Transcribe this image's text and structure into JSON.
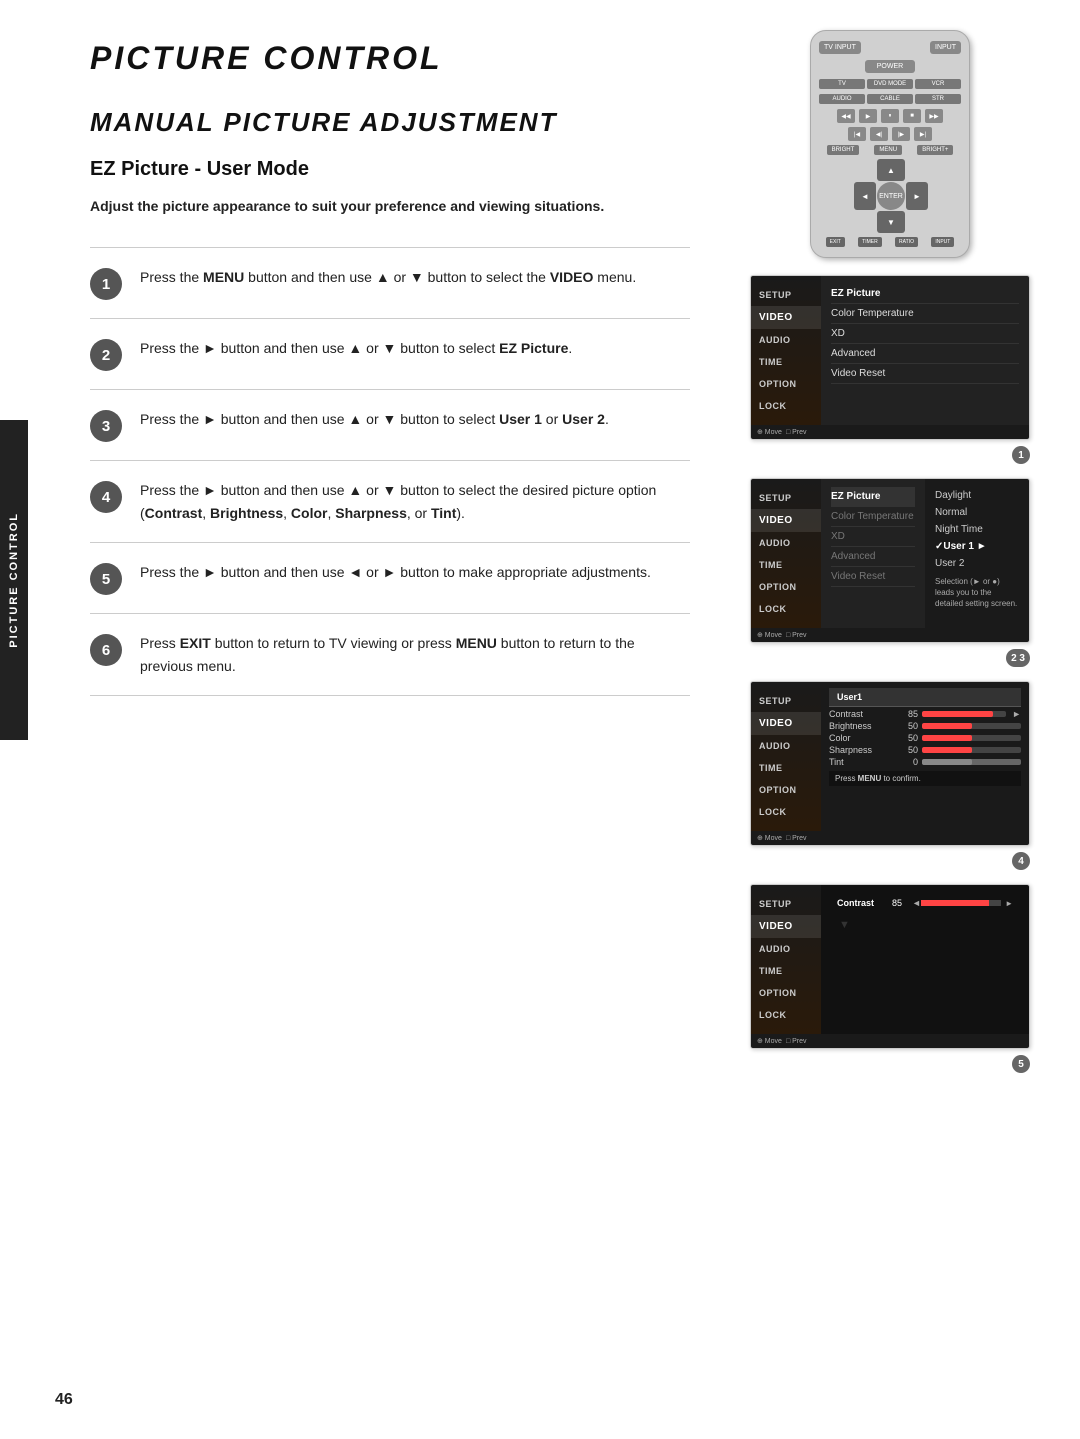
{
  "page": {
    "title": "PICTURE CONTROL",
    "section_title": "MANUAL PICTURE ADJUSTMENT",
    "subsection_title": "EZ Picture - User Mode",
    "intro_text": "Adjust the picture appearance to suit your preference and viewing situations.",
    "page_number": "46",
    "side_tab_label": "PICTURE CONTROL"
  },
  "steps": [
    {
      "number": "1",
      "text_parts": [
        "Press the ",
        "MENU",
        " button and then use ▲ or ▼ button to select the ",
        "VIDEO",
        " menu."
      ]
    },
    {
      "number": "2",
      "text_parts": [
        "Press the ► button and then use ▲ or ▼ button to select ",
        "EZ Picture",
        "."
      ]
    },
    {
      "number": "3",
      "text_parts": [
        "Press the ► button and then use ▲ or ▼ button to select ",
        "User 1",
        " or ",
        "User 2",
        "."
      ]
    },
    {
      "number": "4",
      "text_parts": [
        "Press the ► button and then use ▲ or ▼ button to select the desired picture option (",
        "Contrast",
        ", ",
        "Brightness",
        ", ",
        "Color",
        ", ",
        "Sharpness",
        ", or ",
        "Tint",
        ")."
      ]
    },
    {
      "number": "5",
      "text_parts": [
        "Press the ► button and then use ◄ or ► button to make appropriate adjustments."
      ]
    },
    {
      "number": "6",
      "text_parts": [
        "Press ",
        "EXIT",
        " button to return to TV viewing or press ",
        "MENU",
        " button to return to the previous menu."
      ]
    }
  ],
  "remote": {
    "tv_input_label": "TV INPUT",
    "input_label": "INPUT",
    "power_label": "POWER",
    "mode_buttons": [
      "TV",
      "DVD MODE",
      "VCR"
    ],
    "audio_cable_str": [
      "AUDIO",
      "CABLE",
      "STR"
    ],
    "menu_label": "MENU",
    "enter_label": "ENTER",
    "exit_label": "EXIT",
    "timer_label": "TIMER",
    "ratio_label": "RATIO",
    "input2_label": "INPUT"
  },
  "screenshots": [
    {
      "badge": "1",
      "sidebar_items": [
        "SETUP",
        "VIDEO",
        "AUDIO",
        "TIME",
        "OPTION",
        "LOCK"
      ],
      "active_sidebar": "VIDEO",
      "menu_items": [
        "EZ Picture",
        "Color Temperature",
        "XD",
        "Advanced",
        "Video Reset"
      ],
      "selected_menu": "EZ Picture",
      "nav_text": "Move   Prev"
    },
    {
      "badge": "2 3",
      "sidebar_items": [
        "SETUP",
        "VIDEO",
        "AUDIO",
        "TIME",
        "OPTION",
        "LOCK"
      ],
      "active_sidebar": "VIDEO",
      "menu_items": [
        "EZ Picture",
        "Color Temperature",
        "XD",
        "Advanced",
        "Video Reset"
      ],
      "selected_menu": "EZ Picture",
      "options": [
        "Daylight",
        "Normal",
        "Night Time",
        "✓User 1",
        "User 2"
      ],
      "selected_option": "✓User 1",
      "note": "Selection (► or ●) leads you to the detailed setting screen.",
      "nav_text": "Move   Prev"
    },
    {
      "badge": "4",
      "sidebar_items": [
        "SETUP",
        "VIDEO",
        "AUDIO",
        "TIME",
        "OPTION",
        "LOCK"
      ],
      "active_sidebar": "VIDEO",
      "title": "User1",
      "rows": [
        {
          "label": "Contrast",
          "value": "85",
          "pct": 85
        },
        {
          "label": "Brightness",
          "value": "50",
          "pct": 50
        },
        {
          "label": "Color",
          "value": "50",
          "pct": 50
        },
        {
          "label": "Sharpness",
          "value": "50",
          "pct": 50
        },
        {
          "label": "Tint",
          "value": "0",
          "pct": 50,
          "tint": true
        }
      ],
      "confirm_text": "Press MENU to confirm.",
      "nav_text": "Move   Prev"
    },
    {
      "badge": "5",
      "sidebar_items": [
        "SETUP",
        "VIDEO",
        "AUDIO",
        "TIME",
        "OPTION",
        "LOCK"
      ],
      "active_sidebar": "VIDEO",
      "contrast_label": "Contrast",
      "contrast_value": "85",
      "contrast_pct": 85,
      "nav_text": "Move   Prev"
    }
  ]
}
